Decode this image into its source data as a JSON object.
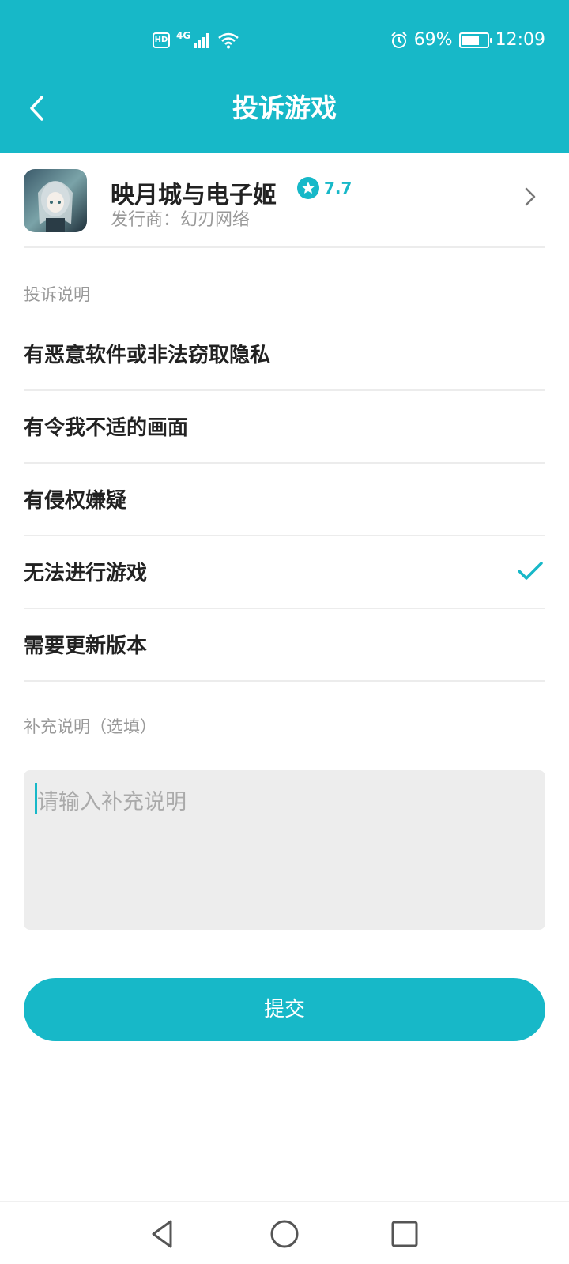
{
  "status_bar": {
    "hd": "HD",
    "network": "4G",
    "battery_percent": "69%",
    "battery_level": 0.69,
    "time": "12:09",
    "icons": [
      "hd-icon",
      "signal-icon",
      "wifi-icon",
      "alarm-icon",
      "battery-icon"
    ]
  },
  "header": {
    "title": "投诉游戏",
    "back_icon": "chevron-left-icon"
  },
  "game": {
    "name": "映月城与电子姬",
    "rating": "7.7",
    "publisher": "发行商：幻刃网络",
    "icon": "game-cover-icon"
  },
  "complaint": {
    "section_label": "投诉说明",
    "reasons": [
      {
        "label": "有恶意软件或非法窃取隐私",
        "selected": false
      },
      {
        "label": "有令我不适的画面",
        "selected": false
      },
      {
        "label": "有侵权嫌疑",
        "selected": false
      },
      {
        "label": "无法进行游戏",
        "selected": true
      },
      {
        "label": "需要更新版本",
        "selected": false
      }
    ]
  },
  "supplement": {
    "section_label": "补充说明（选填）",
    "placeholder": "请输入补充说明",
    "value": ""
  },
  "submit_label": "提交",
  "nav": [
    "back-triangle-icon",
    "home-circle-icon",
    "recents-square-icon"
  ],
  "colors": {
    "accent": "#17b8c8",
    "text_primary": "#222222",
    "text_secondary": "#999999",
    "input_bg": "#ededed"
  }
}
